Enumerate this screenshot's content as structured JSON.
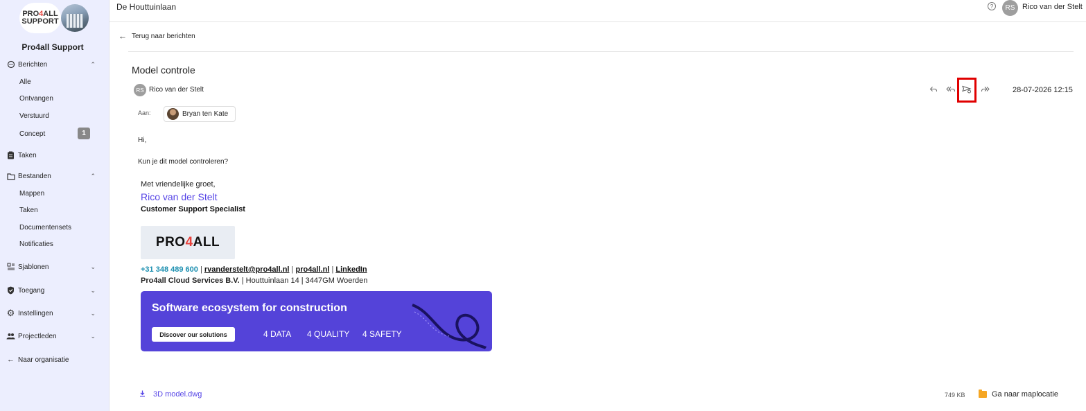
{
  "sidebar": {
    "logo_text_1": "PRO4ALL",
    "logo_text_2": "SUPPORT",
    "org_name": "Pro4all Support",
    "berichten": {
      "label": "Berichten",
      "icon": "chat-icon",
      "expanded": true
    },
    "berichten_items": [
      "Alle",
      "Ontvangen",
      "Verstuurd",
      "Concept"
    ],
    "concept_count": "1",
    "taken": {
      "label": "Taken",
      "icon": "clipboard-icon"
    },
    "bestanden": {
      "label": "Bestanden",
      "icon": "folder-icon",
      "expanded": true
    },
    "bestanden_items": [
      "Mappen",
      "Taken",
      "Documentensets",
      "Notificaties"
    ],
    "sjablonen": {
      "label": "Sjablonen",
      "icon": "template-icon"
    },
    "toegang": {
      "label": "Toegang",
      "icon": "shield-icon"
    },
    "instellingen": {
      "label": "Instellingen",
      "icon": "gear-icon"
    },
    "projectleden": {
      "label": "Projectleden",
      "icon": "people-icon"
    },
    "naar_organisatie": {
      "label": "Naar organisatie",
      "icon": "arrow-left-icon"
    }
  },
  "header": {
    "project": "De Houttuinlaan",
    "help_icon": "?",
    "user_initials": "RS",
    "user_name": "Rico van der Stelt"
  },
  "message": {
    "back_label": "Terug naar berichten",
    "subject": "Model controle",
    "sender_initials": "RS",
    "sender_name": "Rico van der Stelt",
    "date": "28-07-2026 12:15",
    "to_label": "Aan:",
    "recipient": "Bryan ten Kate",
    "body_greeting": "Hi,",
    "body_line": "Kun je dit model controleren?",
    "actions": [
      "reply-icon",
      "reply-all-icon",
      "send-icon",
      "forward-icon"
    ],
    "highlight_color": "#e00000"
  },
  "signature": {
    "greeting": "Met vriendelijke groet,",
    "name": "Rico van der Stelt",
    "title": "Customer Support Specialist",
    "logo_pre": "PRO",
    "logo_four": "4",
    "logo_post": "ALL",
    "phone": "+31 348 489 600",
    "email": "rvanderstelt@pro4all.nl",
    "website": "pro4all.nl",
    "linkedin": "LinkedIn",
    "separator": "|",
    "company": "Pro4all Cloud Services B.V.",
    "address": "| Houttuinlaan 14 | 3447GM Woerden",
    "banner_title": "Software ecosystem for construction",
    "banner_button": "Discover our solutions",
    "banner_tags": [
      "4 DATA",
      "4 QUALITY",
      "4 SAFETY"
    ],
    "brand_color": "#5443d9"
  },
  "attachment": {
    "name": "3D model.dwg",
    "size": "749 KB",
    "goto_label": "Ga naar maplocatie"
  }
}
